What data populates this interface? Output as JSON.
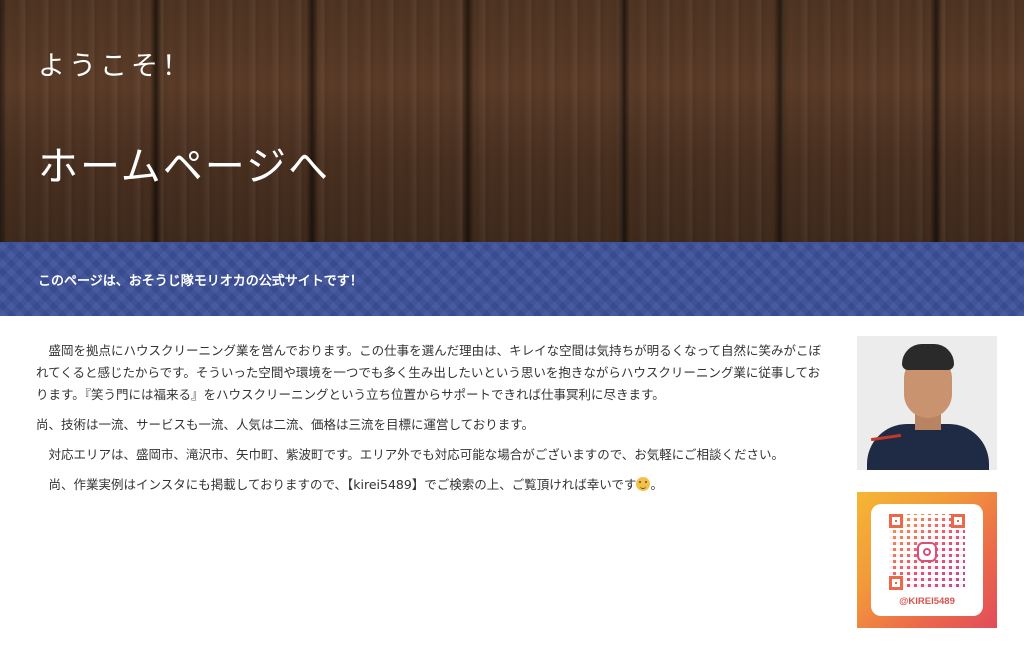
{
  "hero": {
    "greeting": "ようこそ！",
    "title": "ホームページへ"
  },
  "banner": {
    "text": "このページは、おそうじ隊モリオカの公式サイトです！"
  },
  "body": {
    "paragraphs": [
      "　盛岡を拠点にハウスクリーニング業を営んでおります。この仕事を選んだ理由は、キレイな空間は気持ちが明るくなって自然に笑みがこぼれてくると感じたからです。そういった空間や環境を一つでも多く生み出したいという思いを抱きながらハウスクリーニング業に従事しております。『笑う門には福来る』をハウスクリーニングという立ち位置からサポートできれば仕事冥利に尽きます。",
      "尚、技術は一流、サービスも一流、人気は二流、価格は三流を目標に運営しております。",
      "　対応エリアは、盛岡市、滝沢市、矢巾町、紫波町です。エリア外でも対応可能な場合がございますので、お気軽にご相談ください。",
      "　尚、作業実例はインスタにも掲載しておりますので、【kirei5489】でご検索の上、ご覧頂ければ幸いです"
    ],
    "emoji_icon": "grinning-face-emoji"
  },
  "sidebar": {
    "portrait_icon": "owner-portrait-photo",
    "instagram_handle": "@KIREI5489",
    "qr_icon": "instagram-qr-code"
  },
  "colors": {
    "banner": "#3b4f98",
    "hero_wood": "#4f3422",
    "qr_gradient_start": "#f5b733",
    "qr_gradient_end": "#e24b5a",
    "handle_text": "#d9534f"
  }
}
